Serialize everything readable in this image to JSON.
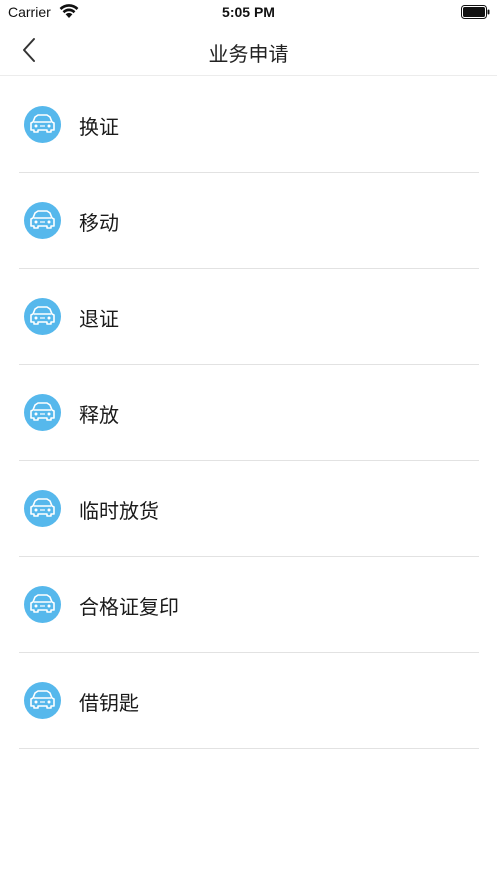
{
  "status_bar": {
    "carrier": "Carrier",
    "time": "5:05 PM"
  },
  "nav": {
    "title": "业务申请",
    "back_icon": "chevron-left-icon"
  },
  "items": [
    {
      "label": "换证",
      "icon": "car-icon"
    },
    {
      "label": "移动",
      "icon": "car-icon"
    },
    {
      "label": "退证",
      "icon": "car-icon"
    },
    {
      "label": "释放",
      "icon": "car-icon"
    },
    {
      "label": "临时放货",
      "icon": "car-icon"
    },
    {
      "label": "合格证复印",
      "icon": "car-icon"
    },
    {
      "label": "借钥匙",
      "icon": "car-icon"
    }
  ],
  "colors": {
    "icon_bg": "#56b8ec",
    "divider": "#e2e2e2"
  }
}
